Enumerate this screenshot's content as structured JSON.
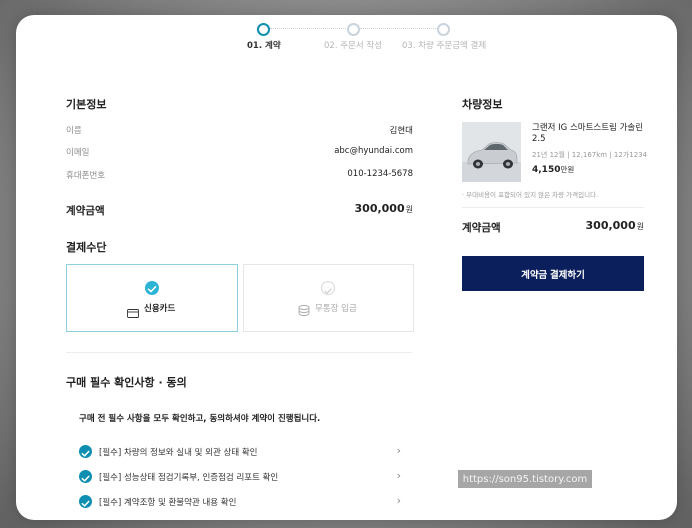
{
  "stepper": {
    "steps": [
      {
        "label": "01. 계약",
        "active": true
      },
      {
        "label": "02. 주문서 작성",
        "active": false
      },
      {
        "label": "03. 차량 주문금액 결제",
        "active": false
      }
    ]
  },
  "basic_info": {
    "title": "기본정보",
    "rows": [
      {
        "label": "이름",
        "value": "김현대"
      },
      {
        "label": "이메일",
        "value": "abc@hyundai.com"
      },
      {
        "label": "휴대폰번호",
        "value": "010-1234-5678"
      }
    ],
    "amount_label": "계약금액",
    "amount_value": "300,000",
    "amount_unit": "원"
  },
  "payment_method": {
    "title": "결제수단",
    "options": [
      {
        "label": "신용카드",
        "icon": "credit-card-icon",
        "selected": true
      },
      {
        "label": "무통장 입금",
        "icon": "coins-icon",
        "selected": false
      }
    ]
  },
  "agreement": {
    "title": "구매 필수 확인사항 · 동의",
    "notice": "구매 전 필수 사항을 모두 확인하고, 동의하셔야 계약이 진행됩니다.",
    "items": [
      {
        "label": "[필수] 차량의 정보와 실내 및 외관 상태 확인"
      },
      {
        "label": "[필수] 성능상태 점검기록부, 인증점검 리포트 확인"
      },
      {
        "label": "[필수] 계약조항 및 환불약관 내용 확인"
      }
    ]
  },
  "vehicle": {
    "title": "차량정보",
    "name": "그랜저 IG 스마트스트림 가솔린 2.5",
    "meta": "21년 12월 | 12,167km | 12가1234",
    "price": "4,150",
    "price_unit": "만원",
    "note": "· 부대비용이 포함되어 있지 않은 차량 가격입니다.",
    "amount_label": "계약금액",
    "amount_value": "300,000",
    "amount_unit": "원",
    "pay_button": "계약금 결제하기"
  },
  "watermark": "https://son95.tistory.com",
  "colors": {
    "accent": "#0e8fb2",
    "button": "#0b1f5c",
    "selected_border": "#8fd0e0"
  }
}
